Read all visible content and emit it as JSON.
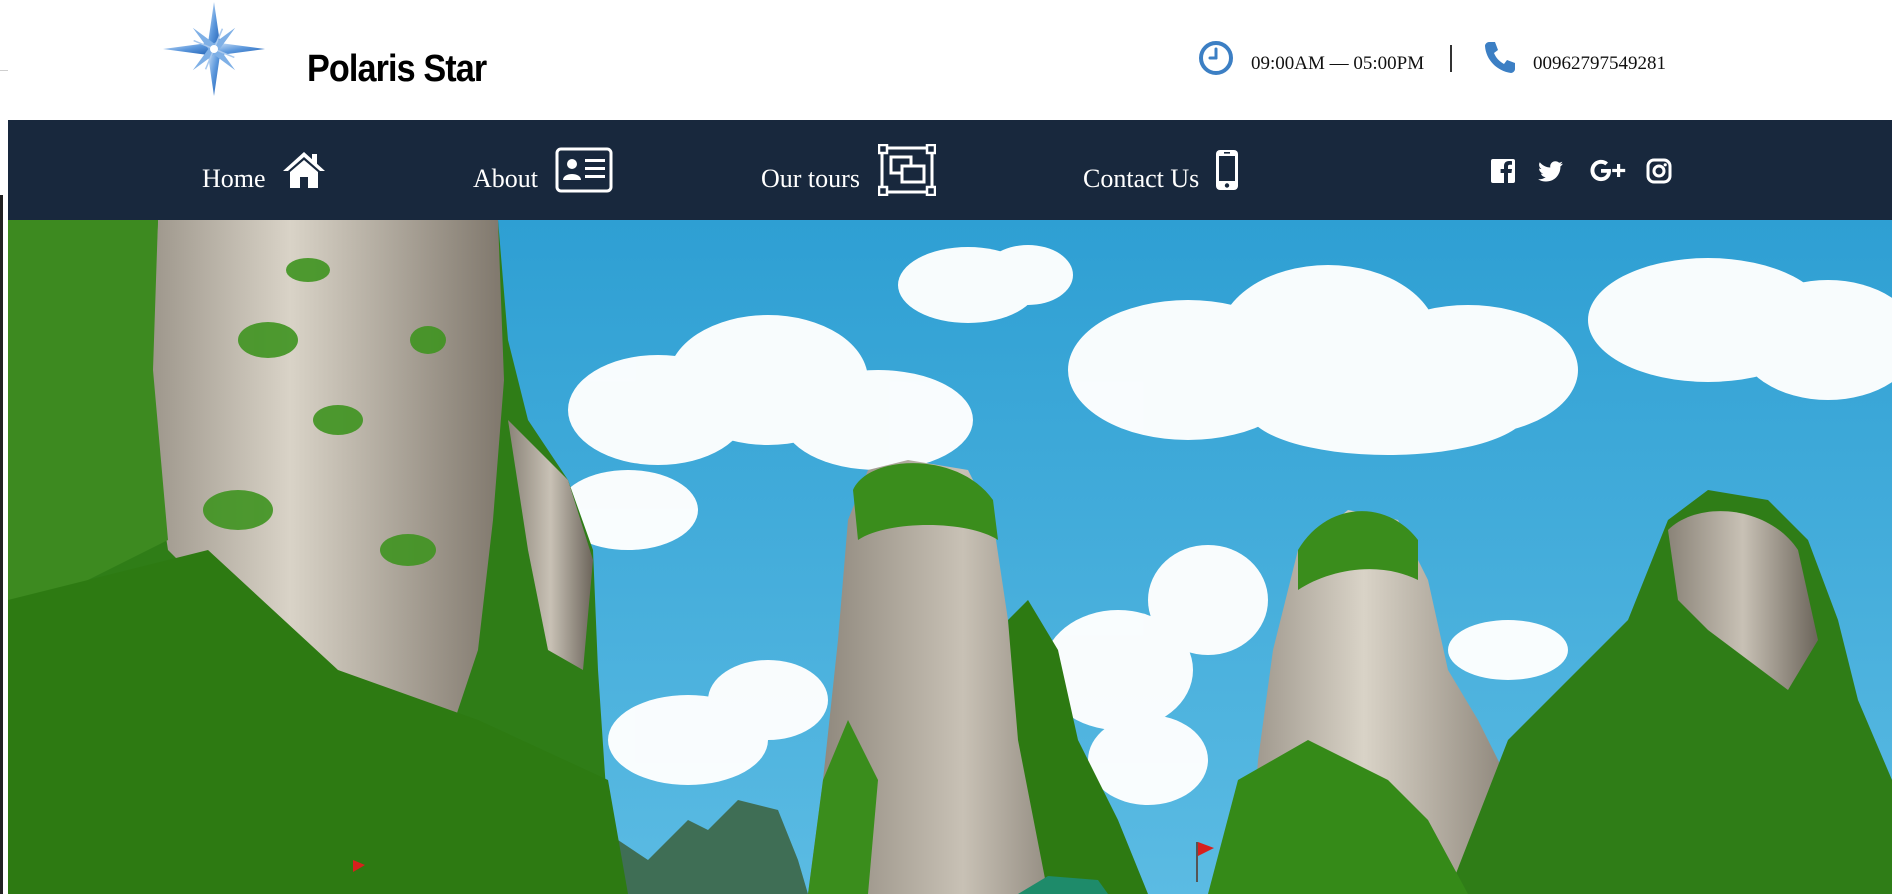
{
  "brand": {
    "name": "Polaris Star"
  },
  "contact": {
    "hours": "09:00AM — 05:00PM",
    "phone": "00962797549281"
  },
  "nav": {
    "items": [
      {
        "label": "Home",
        "icon": "home-icon"
      },
      {
        "label": "About",
        "icon": "id-card-icon"
      },
      {
        "label": "Our tours",
        "icon": "gallery-icon"
      },
      {
        "label": "Contact Us",
        "icon": "mobile-phone-icon"
      }
    ],
    "social": [
      "facebook-icon",
      "twitter-icon",
      "google-plus-icon",
      "instagram-icon"
    ]
  },
  "colors": {
    "navbar": "#18283d",
    "accent_icon": "#3c7fc4",
    "sky": "#3aa9d8",
    "foliage": "#2f7d17"
  }
}
